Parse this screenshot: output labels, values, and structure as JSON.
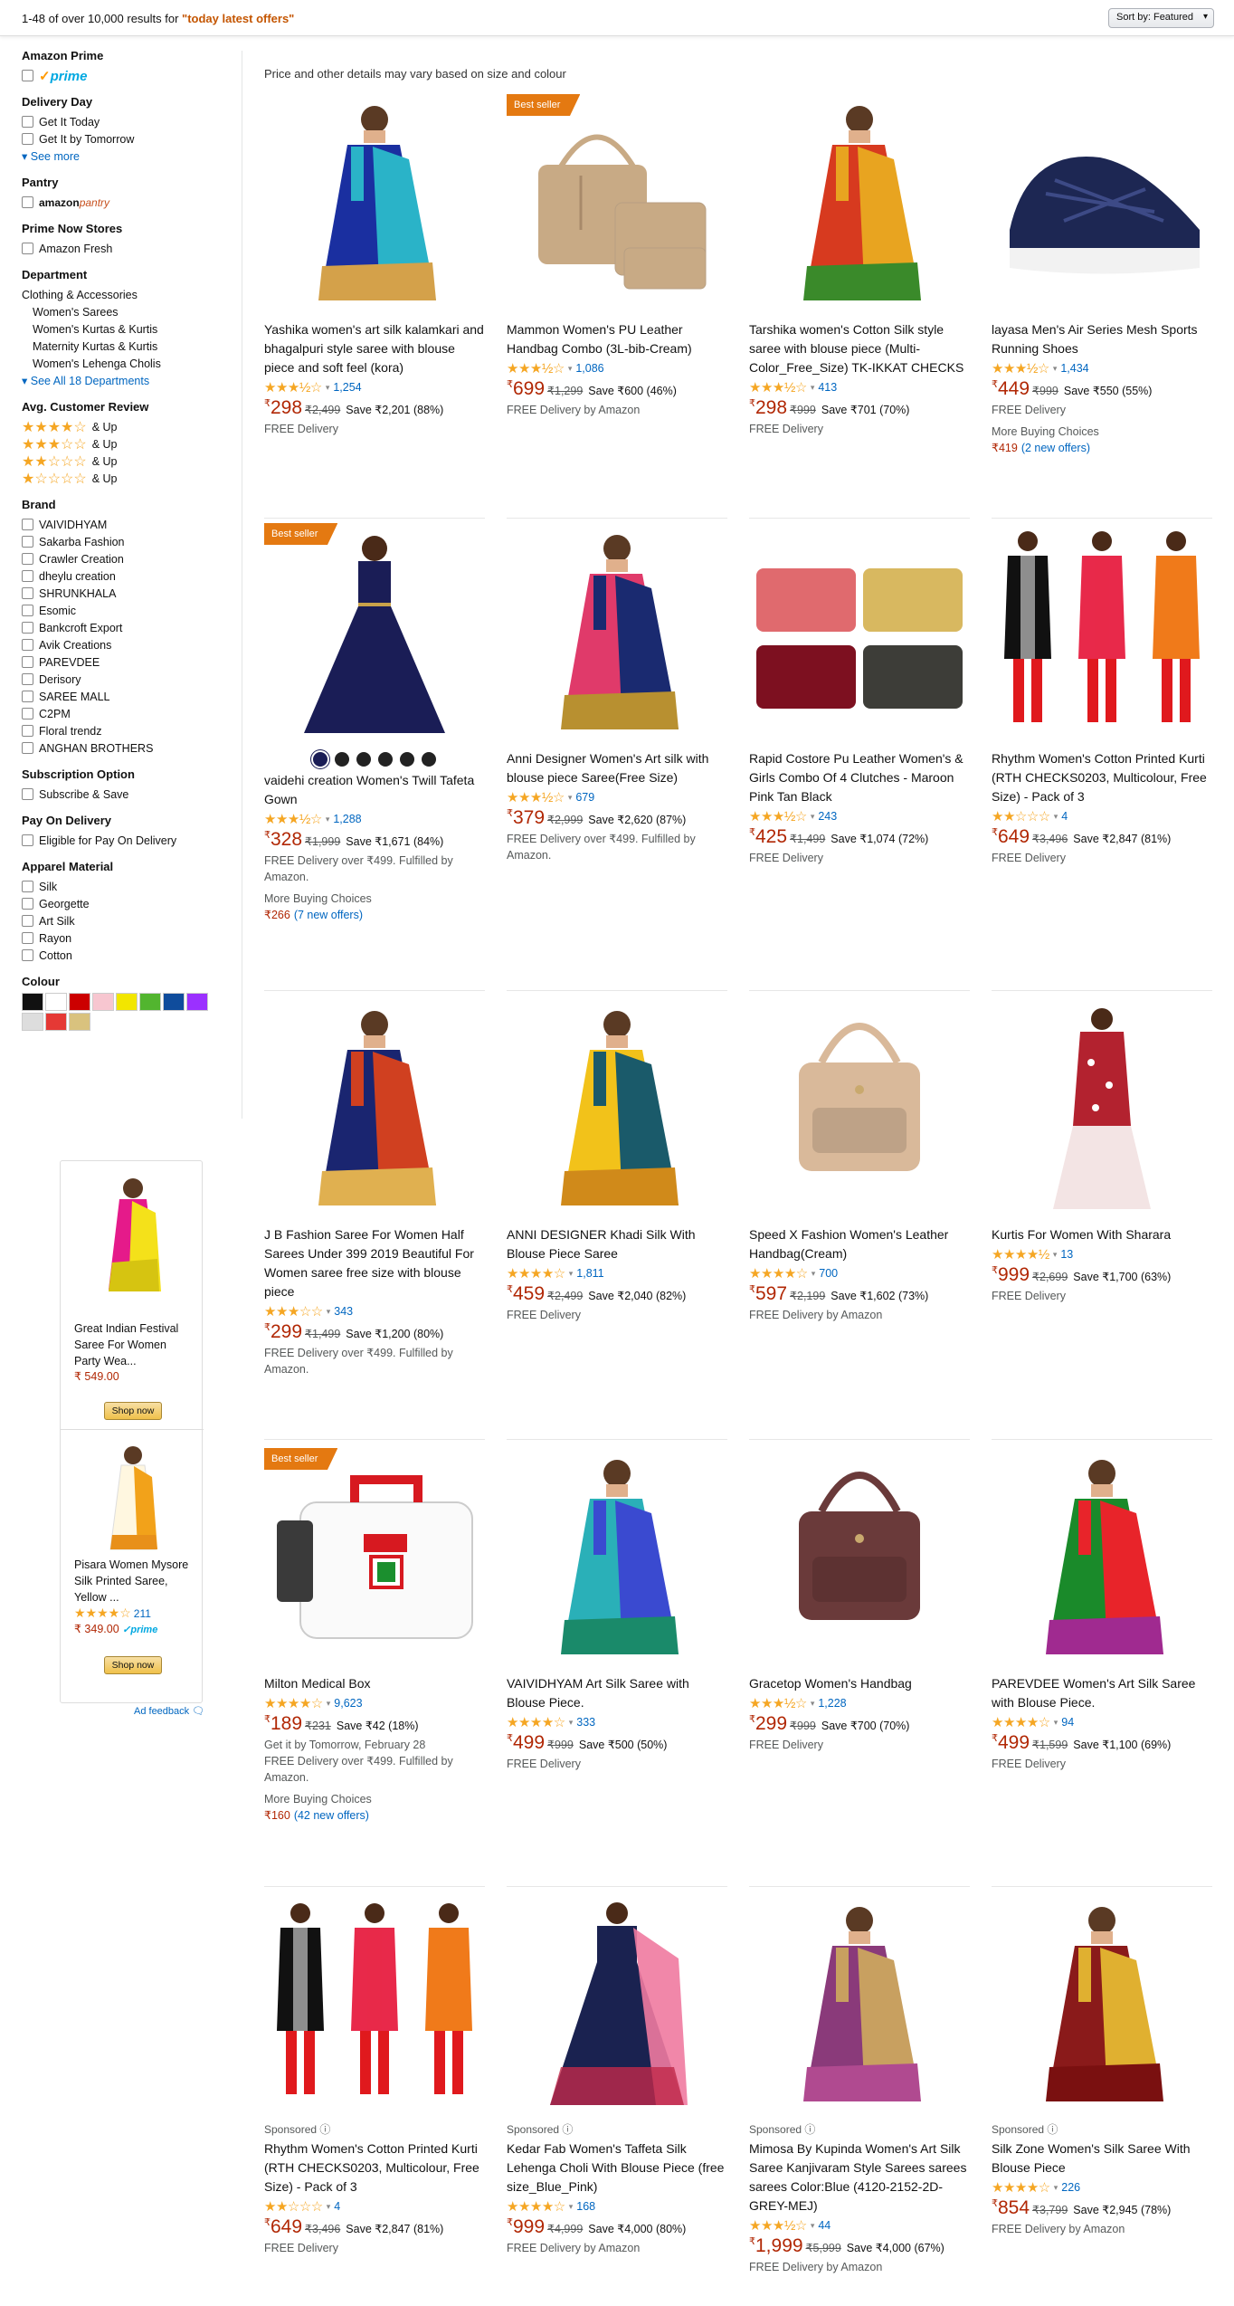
{
  "header": {
    "results_prefix": "1-48 of over 10,000 results for ",
    "query": "\"today latest offers\"",
    "sort_label": "Sort by:",
    "sort_value": "Featured"
  },
  "sidebar": {
    "amazon_prime": {
      "heading": "Amazon Prime",
      "logo_text": "prime"
    },
    "delivery_day": {
      "heading": "Delivery Day",
      "options": [
        "Get It Today",
        "Get It by Tomorrow"
      ],
      "see_more": "See more"
    },
    "pantry": {
      "heading": "Pantry",
      "logo_a": "amazon",
      "logo_b": "pantry"
    },
    "prime_now": {
      "heading": "Prime Now Stores",
      "options": [
        "Amazon Fresh"
      ]
    },
    "department": {
      "heading": "Department",
      "root": "Clothing & Accessories",
      "items": [
        "Women's Sarees",
        "Women's Kurtas & Kurtis",
        "Maternity Kurtas & Kurtis",
        "Women's Lehenga Cholis"
      ],
      "see_all": "See All 18 Departments"
    },
    "review": {
      "heading": "Avg. Customer Review",
      "rows": [
        {
          "stars": "★★★★☆",
          "label": "& Up"
        },
        {
          "stars": "★★★☆☆",
          "label": "& Up"
        },
        {
          "stars": "★★☆☆☆",
          "label": "& Up"
        },
        {
          "stars": "★☆☆☆☆",
          "label": "& Up"
        }
      ]
    },
    "brand": {
      "heading": "Brand",
      "options": [
        "VAIVIDHYAM",
        "Sakarba Fashion",
        "Crawler Creation",
        "dheylu creation",
        "SHRUNKHALA",
        "Esomic",
        "Bankcroft Export",
        "Avik Creations",
        "PAREVDEE",
        "Derisory",
        "SAREE MALL",
        "C2PM",
        "Floral trendz",
        "ANGHAN BROTHERS"
      ]
    },
    "subscription": {
      "heading": "Subscription Option",
      "options": [
        "Subscribe & Save"
      ]
    },
    "pod": {
      "heading": "Pay On Delivery",
      "options": [
        "Eligible for Pay On Delivery"
      ]
    },
    "material": {
      "heading": "Apparel Material",
      "options": [
        "Silk",
        "Georgette",
        "Art Silk",
        "Rayon",
        "Cotton"
      ]
    },
    "colour": {
      "heading": "Colour",
      "swatches": [
        "#111111",
        "#ffffff",
        "#cc0000",
        "#f7c6d0",
        "#f2e600",
        "#52b52f",
        "#0f4c9c",
        "#9b30ff",
        "#dddddd",
        "#e53935",
        "#d9c27e"
      ]
    }
  },
  "ads": {
    "items": [
      {
        "title": "Great Indian Festival Saree For Women Party Wea...",
        "price": "₹ 549.00",
        "button": "Shop now"
      },
      {
        "title": "Pisara Women Mysore Silk Printed Saree, Yellow ...",
        "stars": "★★★★☆",
        "count": "211",
        "prime": "✓prime",
        "price": "₹ 349.00",
        "button": "Shop now"
      }
    ],
    "feedback": "Ad feedback"
  },
  "main": {
    "note": "Price and other details may vary based on size and colour",
    "products": [
      {
        "badge": "",
        "sponsored": "",
        "title": "Yashika women's art silk kalamkari and bhagalpuri style saree with blouse piece and soft feel (kora)",
        "stars": "★★★½☆",
        "count": "1,254",
        "price": "298",
        "mrp": "₹2,499",
        "save": "Save ₹2,201 (88%)",
        "lines": [
          "FREE Delivery"
        ],
        "more": "",
        "offer_price": "",
        "offer_link": ""
      },
      {
        "badge": "Best seller",
        "sponsored": "",
        "title": "Mammon Women's PU Leather Handbag Combo (3L-bib-Cream)",
        "stars": "★★★½☆",
        "count": "1,086",
        "price": "699",
        "mrp": "₹1,299",
        "save": "Save ₹600 (46%)",
        "lines": [
          "FREE Delivery by Amazon"
        ],
        "more": "",
        "offer_price": "",
        "offer_link": ""
      },
      {
        "badge": "",
        "sponsored": "",
        "title": "Tarshika women's Cotton Silk style saree with blouse piece (Multi-Color_Free_Size) TK-IKKAT CHECKS",
        "stars": "★★★½☆",
        "count": "413",
        "price": "298",
        "mrp": "₹999",
        "save": "Save ₹701 (70%)",
        "lines": [
          "FREE Delivery"
        ],
        "more": "",
        "offer_price": "",
        "offer_link": ""
      },
      {
        "badge": "",
        "sponsored": "",
        "title": "layasa Men's Air Series Mesh Sports Running Shoes",
        "stars": "★★★½☆",
        "count": "1,434",
        "price": "449",
        "mrp": "₹999",
        "save": "Save ₹550 (55%)",
        "lines": [
          "FREE Delivery"
        ],
        "more": "More Buying Choices",
        "offer_price": "₹419",
        "offer_link": "(2 new offers)"
      },
      {
        "badge": "Best seller",
        "sponsored": "",
        "title": "vaidehi creation Women's Twill Tafeta Gown",
        "stars": "★★★½☆",
        "count": "1,288",
        "price": "328",
        "mrp": "₹1,999",
        "save": "Save ₹1,671 (84%)",
        "lines": [
          "FREE Delivery over ₹499. Fulfilled by Amazon."
        ],
        "more": "More Buying Choices",
        "offer_price": "₹266",
        "offer_link": "(7 new offers)"
      },
      {
        "badge": "",
        "sponsored": "",
        "title": "Anni Designer Women's Art silk with blouse piece Saree(Free Size)",
        "stars": "★★★½☆",
        "count": "679",
        "price": "379",
        "mrp": "₹2,999",
        "save": "Save ₹2,620 (87%)",
        "lines": [
          "FREE Delivery over ₹499. Fulfilled by Amazon."
        ],
        "more": "",
        "offer_price": "",
        "offer_link": ""
      },
      {
        "badge": "",
        "sponsored": "",
        "title": "Rapid Costore Pu Leather Women's & Girls Combo Of 4 Clutches - Maroon Pink Tan Black",
        "stars": "★★★½☆",
        "count": "243",
        "price": "425",
        "mrp": "₹1,499",
        "save": "Save ₹1,074 (72%)",
        "lines": [
          "FREE Delivery"
        ],
        "more": "",
        "offer_price": "",
        "offer_link": ""
      },
      {
        "badge": "",
        "sponsored": "",
        "title": "Rhythm Women's Cotton Printed Kurti (RTH CHECKS0203, Multicolour, Free Size) - Pack of 3",
        "stars": "★★☆☆☆",
        "count": "4",
        "price": "649",
        "mrp": "₹3,496",
        "save": "Save ₹2,847 (81%)",
        "lines": [
          "FREE Delivery"
        ],
        "more": "",
        "offer_price": "",
        "offer_link": ""
      },
      {
        "badge": "",
        "sponsored": "",
        "title": "J B Fashion Saree For Women Half Sarees Under 399 2019 Beautiful For Women saree free size with blouse piece",
        "stars": "★★★☆☆",
        "count": "343",
        "price": "299",
        "mrp": "₹1,499",
        "save": "Save ₹1,200 (80%)",
        "lines": [
          "FREE Delivery over ₹499. Fulfilled by Amazon."
        ],
        "more": "",
        "offer_price": "",
        "offer_link": ""
      },
      {
        "badge": "",
        "sponsored": "",
        "title": "ANNI DESIGNER Khadi Silk With Blouse Piece Saree",
        "stars": "★★★★☆",
        "count": "1,811",
        "price": "459",
        "mrp": "₹2,499",
        "save": "Save ₹2,040 (82%)",
        "lines": [
          "FREE Delivery"
        ],
        "more": "",
        "offer_price": "",
        "offer_link": ""
      },
      {
        "badge": "",
        "sponsored": "",
        "title": "Speed X Fashion Women's Leather Handbag(Cream)",
        "stars": "★★★★☆",
        "count": "700",
        "price": "597",
        "mrp": "₹2,199",
        "save": "Save ₹1,602 (73%)",
        "lines": [
          "FREE Delivery by Amazon"
        ],
        "more": "",
        "offer_price": "",
        "offer_link": ""
      },
      {
        "badge": "",
        "sponsored": "",
        "title": "Kurtis For Women With Sharara",
        "stars": "★★★★½",
        "count": "13",
        "price": "999",
        "mrp": "₹2,699",
        "save": "Save ₹1,700 (63%)",
        "lines": [
          "FREE Delivery"
        ],
        "more": "",
        "offer_price": "",
        "offer_link": ""
      },
      {
        "badge": "Best seller",
        "sponsored": "",
        "title": "Milton Medical Box",
        "stars": "★★★★☆",
        "count": "9,623",
        "price": "189",
        "mrp": "₹231",
        "save": "Save ₹42 (18%)",
        "lines": [
          "Get it by Tomorrow, February 28",
          "FREE Delivery over ₹499. Fulfilled by Amazon."
        ],
        "more": "More Buying Choices",
        "offer_price": "₹160",
        "offer_link": "(42 new offers)"
      },
      {
        "badge": "",
        "sponsored": "",
        "title": "VAIVIDHYAM Art Silk Saree with Blouse Piece.",
        "stars": "★★★★☆",
        "count": "333",
        "price": "499",
        "mrp": "₹999",
        "save": "Save ₹500 (50%)",
        "lines": [
          "FREE Delivery"
        ],
        "more": "",
        "offer_price": "",
        "offer_link": ""
      },
      {
        "badge": "",
        "sponsored": "",
        "title": "Gracetop Women's Handbag",
        "stars": "★★★½☆",
        "count": "1,228",
        "price": "299",
        "mrp": "₹999",
        "save": "Save ₹700 (70%)",
        "lines": [
          "FREE Delivery"
        ],
        "more": "",
        "offer_price": "",
        "offer_link": ""
      },
      {
        "badge": "",
        "sponsored": "",
        "title": "PAREVDEE Women's Art Silk Saree with Blouse Piece.",
        "stars": "★★★★☆",
        "count": "94",
        "price": "499",
        "mrp": "₹1,599",
        "save": "Save ₹1,100 (69%)",
        "lines": [
          "FREE Delivery"
        ],
        "more": "",
        "offer_price": "",
        "offer_link": ""
      },
      {
        "badge": "",
        "sponsored": "Sponsored ⓘ",
        "title": "Rhythm Women's Cotton Printed Kurti (RTH CHECKS0203, Multicolour, Free Size) - Pack of 3",
        "stars": "★★☆☆☆",
        "count": "4",
        "price": "649",
        "mrp": "₹3,496",
        "save": "Save ₹2,847 (81%)",
        "lines": [
          "FREE Delivery"
        ],
        "more": "",
        "offer_price": "",
        "offer_link": ""
      },
      {
        "badge": "",
        "sponsored": "Sponsored ⓘ",
        "title": "Kedar Fab Women's Taffeta Silk Lehenga Choli With Blouse Piece (free size_Blue_Pink)",
        "stars": "★★★★☆",
        "count": "168",
        "price": "999",
        "mrp": "₹4,999",
        "save": "Save ₹4,000 (80%)",
        "lines": [
          "FREE Delivery by Amazon"
        ],
        "more": "",
        "offer_price": "",
        "offer_link": ""
      },
      {
        "badge": "",
        "sponsored": "Sponsored ⓘ",
        "title": "Mimosa By Kupinda Women's Art Silk Saree Kanjivaram Style Sarees sarees sarees Color:Blue (4120-2152-2D-GREY-MEJ)",
        "stars": "★★★½☆",
        "count": "44",
        "price": "1,999",
        "mrp": "₹5,999",
        "save": "Save ₹4,000 (67%)",
        "lines": [
          "FREE Delivery by Amazon"
        ],
        "more": "",
        "offer_price": "",
        "offer_link": ""
      },
      {
        "badge": "",
        "sponsored": "Sponsored ⓘ",
        "title": "Silk Zone Women's Silk Saree With Blouse Piece",
        "stars": "★★★★☆",
        "count": "226",
        "price": "854",
        "mrp": "₹3,799",
        "save": "Save ₹2,945 (78%)",
        "lines": [
          "FREE Delivery by Amazon"
        ],
        "more": "",
        "offer_price": "",
        "offer_link": ""
      }
    ]
  },
  "colors": {
    "price": "#b12704",
    "link": "#0066c0",
    "star": "#f5a623",
    "badge": "#e47911"
  }
}
